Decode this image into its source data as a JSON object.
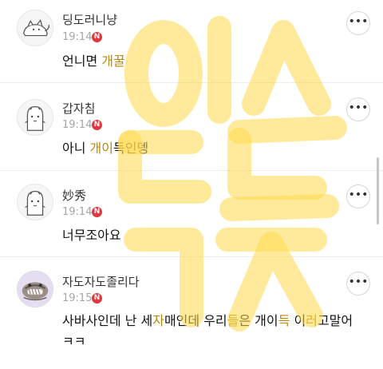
{
  "badge_label": "N",
  "more_label": "•••",
  "comments": [
    {
      "user": "딩도러니냥",
      "time": "19:14",
      "text_parts": [
        "언니면 ",
        "개꿀"
      ]
    },
    {
      "user": "갑자침",
      "time": "19:14",
      "text_parts": [
        "아니 ",
        "개이",
        "득인뎅"
      ]
    },
    {
      "user": "妙秀",
      "time": "19:14",
      "text_parts": [
        "너무조아요"
      ]
    },
    {
      "user": "자도자도졸리다",
      "time": "19:15",
      "text_parts": [
        "사바사인데 난 세",
        "자",
        "매인데 우리",
        "들",
        "은 개이",
        "득",
        " 이",
        "러",
        "고말어",
        "ㅋㅋ"
      ]
    }
  ],
  "watermark_text": "이스트",
  "colors": {
    "badge": "#e0383e",
    "highlight_text": "#b78a0c",
    "watermark": "#ffd84a"
  }
}
